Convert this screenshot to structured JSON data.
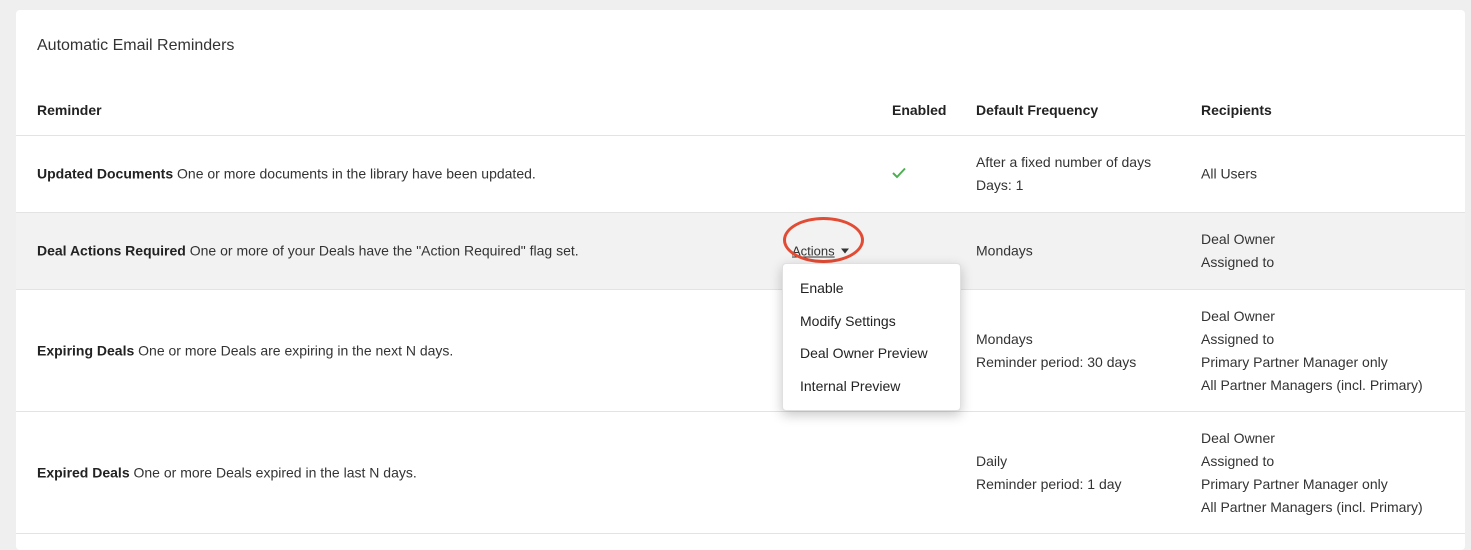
{
  "card": {
    "title": "Automatic Email Reminders"
  },
  "table": {
    "headers": {
      "reminder": "Reminder",
      "enabled": "Enabled",
      "frequency": "Default Frequency",
      "recipients": "Recipients"
    },
    "rows": [
      {
        "name": "Updated Documents",
        "description": "One or more documents in the library have been updated.",
        "enabled": true,
        "frequency": [
          "After a fixed number of days",
          "Days: 1"
        ],
        "recipients": [
          "All Users"
        ]
      },
      {
        "name": "Deal Actions Required",
        "description": "One or more of your Deals have the \"Action Required\" flag set.",
        "enabled": false,
        "actions_label": "Actions",
        "frequency": [
          "Mondays"
        ],
        "recipients": [
          "Deal Owner",
          "Assigned to"
        ]
      },
      {
        "name": "Expiring Deals",
        "description": "One or more Deals are expiring in the next N days.",
        "enabled": false,
        "frequency": [
          "Mondays",
          "Reminder period: 30 days"
        ],
        "recipients": [
          "Deal Owner",
          "Assigned to",
          "Primary Partner Manager only",
          "All Partner Managers (incl. Primary)"
        ]
      },
      {
        "name": "Expired Deals",
        "description": "One or more Deals expired in the last N days.",
        "enabled": false,
        "frequency": [
          "Daily",
          "Reminder period: 1 day"
        ],
        "recipients": [
          "Deal Owner",
          "Assigned to",
          "Primary Partner Manager only",
          "All Partner Managers (incl. Primary)"
        ]
      }
    ]
  },
  "actions_menu": {
    "items": [
      "Enable",
      "Modify Settings",
      "Deal Owner Preview",
      "Internal Preview"
    ]
  },
  "colors": {
    "check": "#4caf50",
    "highlight_circle": "#e24b34",
    "row_highlight": "#f2f2f2"
  },
  "icons": {
    "enabled": "check-icon",
    "dropdown": "caret-down-icon"
  }
}
